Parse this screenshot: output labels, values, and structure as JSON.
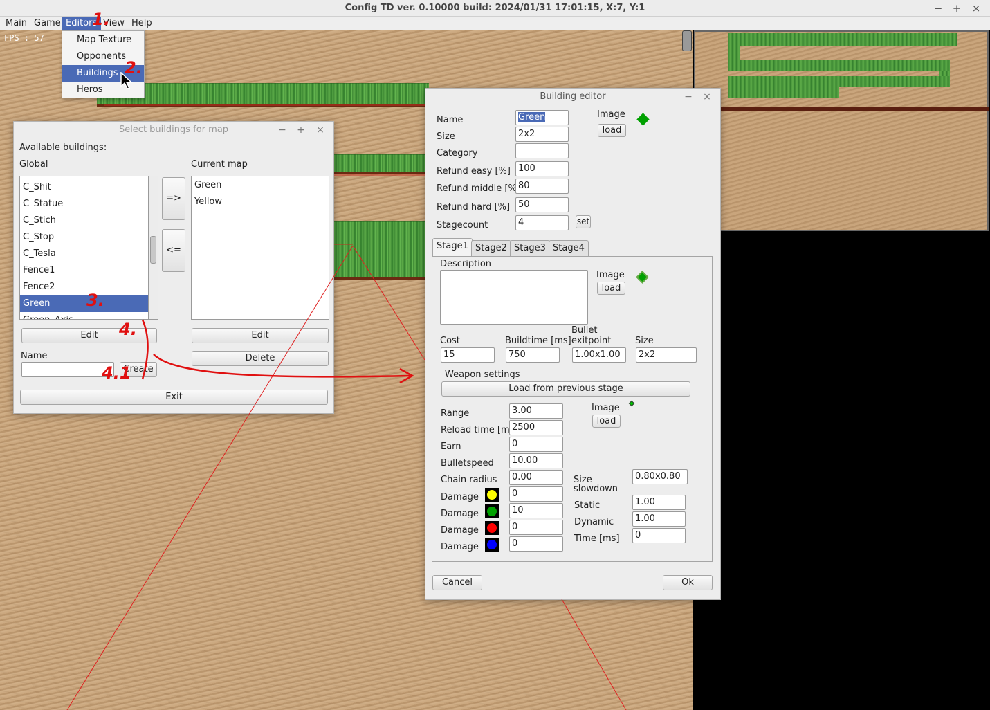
{
  "window": {
    "title": "Config TD ver. 0.10000 build: 2024/01/31  17:01:15, X:7, Y:1",
    "minimize": "−",
    "maximize": "+",
    "close": "×"
  },
  "menubar": {
    "items": [
      "Main",
      "Game",
      "Editors",
      "View",
      "Help"
    ],
    "active": "Editors"
  },
  "editors_menu": {
    "items": [
      "Map Texture",
      "Opponents",
      "Buildings",
      "Heros"
    ],
    "selected": "Buildings"
  },
  "game": {
    "fps_label": "FPS : 57"
  },
  "select_dialog": {
    "title": "Select buildings for map",
    "available_label": "Available buildings:",
    "global_label": "Global",
    "current_map_label": "Current map",
    "global_items": [
      "C_Shit",
      "C_Statue",
      "C_Stich",
      "C_Stop",
      "C_Tesla",
      "Fence1",
      "Fence2",
      "Green",
      "Green_Axis"
    ],
    "selected_global": "Green",
    "current_items": [
      "Green",
      "Yellow"
    ],
    "add_button": "=>",
    "remove_button": "<=",
    "edit_global_button": "Edit",
    "edit_current_button": "Edit",
    "delete_button": "Delete",
    "name_label": "Name",
    "name_value": "",
    "create_button": "Create",
    "exit_button": "Exit"
  },
  "building_editor": {
    "title": "Building editor",
    "name_label": "Name",
    "name_value": "Green",
    "size_label": "Size",
    "size_value": "2x2",
    "category_label": "Category",
    "category_value": "",
    "refund_easy_label": "Refund easy [%]",
    "refund_easy_value": "100",
    "refund_middle_label": "Refund middle [%]",
    "refund_middle_value": "80",
    "refund_hard_label": "Refund hard [%]",
    "refund_hard_value": "50",
    "stagecount_label": "Stagecount",
    "stagecount_value": "4",
    "set_button": "set",
    "image_label": "Image",
    "load_button": "load",
    "tabs": [
      "Stage1",
      "Stage2",
      "Stage3",
      "Stage4"
    ],
    "active_tab": "Stage1",
    "stage": {
      "description_label": "Description",
      "description_value": "",
      "image_label": "Image",
      "load_button": "load",
      "cost_label": "Cost",
      "cost_value": "15",
      "buildtime_label": "Buildtime [ms]",
      "buildtime_value": "750",
      "bullet_exit_label_1": "Bullet",
      "bullet_exit_label_2": "exitpoint",
      "bullet_exit_value": "1.00x1.00",
      "size_label": "Size",
      "size_value": "2x2",
      "weapon_settings_label": "Weapon settings",
      "load_prev_button": "Load from previous stage",
      "range_label": "Range",
      "range_value": "3.00",
      "reload_label": "Reload time [ms]",
      "reload_value": "2500",
      "earn_label": "Earn",
      "earn_value": "0",
      "bulletspeed_label": "Bulletspeed",
      "bulletspeed_value": "10.00",
      "chain_radius_label": "Chain radius",
      "chain_radius_value": "0.00",
      "weapon_image_label": "Image",
      "weapon_load_button": "load",
      "bullet_size_label": "Size",
      "bullet_size_value": "0.80x0.80",
      "slowdown_label": "slowdown",
      "static_label": "Static",
      "static_value": "1.00",
      "dynamic_label": "Dynamic",
      "dynamic_value": "1.00",
      "time_label": "Time [ms]",
      "time_value": "0",
      "damage_rows": [
        {
          "label": "Damage",
          "color": "#ffff00",
          "value": "0"
        },
        {
          "label": "Damage",
          "color": "#00a000",
          "value": "10"
        },
        {
          "label": "Damage",
          "color": "#ff0000",
          "value": "0"
        },
        {
          "label": "Damage",
          "color": "#0000ff",
          "value": "0"
        }
      ]
    },
    "cancel_button": "Cancel",
    "ok_button": "Ok"
  },
  "annotations": [
    "1.",
    "2.",
    "3.",
    "4.",
    "4.1"
  ],
  "colors": {
    "accent": "#4a6ab6",
    "building_color": "#00a000",
    "annotation": "#e01010"
  }
}
